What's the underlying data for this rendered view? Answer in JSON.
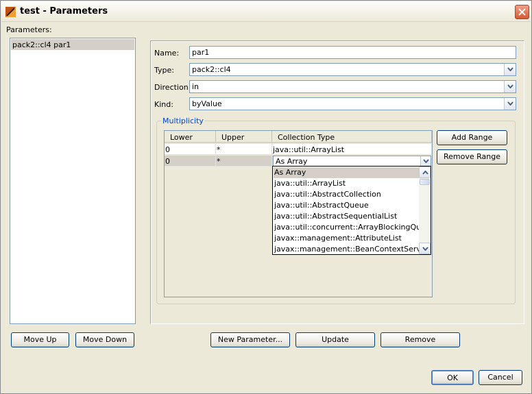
{
  "window": {
    "title": "test - Parameters"
  },
  "parameters": {
    "label": "Parameters:",
    "items": [
      "pack2::cl4 par1"
    ],
    "move_up": "Move Up",
    "move_down": "Move Down"
  },
  "form": {
    "name_label": "Name:",
    "name_value": "par1",
    "type_label": "Type:",
    "type_value": "pack2::cl4",
    "direction_label": "Direction:",
    "direction_value": "in",
    "kind_label": "Kind:",
    "kind_value": "byValue"
  },
  "multiplicity": {
    "title": "Multiplicity",
    "columns": [
      "Lower",
      "Upper",
      "Collection Type"
    ],
    "rows": [
      {
        "lower": "0",
        "upper": "*",
        "collection": "java::util::ArrayList"
      },
      {
        "lower": "0",
        "upper": "*",
        "collection": "As Array"
      }
    ],
    "add_range": "Add Range",
    "remove_range": "Remove Range",
    "dropdown_options": [
      "As Array",
      "java::util::ArrayList",
      "java::util::AbstractCollection",
      "java::util::AbstractQueue",
      "java::util::AbstractSequentialList",
      "java::util::concurrent::ArrayBlockingQueue",
      "javax::management::AttributeList",
      "javax::management::BeanContextServicesS"
    ],
    "dropdown_selected": "As Array"
  },
  "actions": {
    "new_parameter": "New Parameter...",
    "update": "Update",
    "remove": "Remove",
    "ok": "OK",
    "cancel": "Cancel"
  },
  "colors": {
    "window_bg": "#ece9d8",
    "border_blue": "#7f9db9",
    "group_title": "#0046d5",
    "selection": "#d4d0c8"
  }
}
